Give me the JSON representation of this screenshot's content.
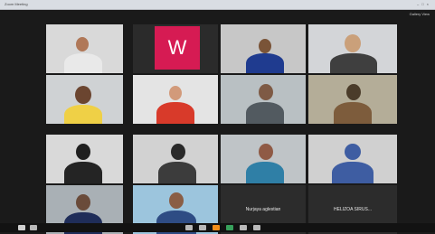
{
  "window": {
    "title": "Zoom Meeting",
    "controls": "–□×"
  },
  "top_right_info": "Gallery View",
  "participants": [
    {
      "id": "p1",
      "label": ""
    },
    {
      "id": "p2",
      "label": "",
      "initial": "W"
    },
    {
      "id": "p3",
      "label": ""
    },
    {
      "id": "p4",
      "label": ""
    },
    {
      "id": "p5",
      "label": ""
    },
    {
      "id": "p6",
      "label": ""
    },
    {
      "id": "p7",
      "label": ""
    },
    {
      "id": "p8",
      "label": ""
    },
    {
      "id": "p9",
      "label": ""
    },
    {
      "id": "p10",
      "label": ""
    },
    {
      "id": "p11",
      "label": ""
    },
    {
      "id": "p12",
      "label": ""
    },
    {
      "id": "p13",
      "label": ""
    },
    {
      "id": "p14",
      "label": ""
    },
    {
      "id": "p15",
      "label": "",
      "name_card": "Nurjaya aglestian"
    },
    {
      "id": "p16",
      "label": "",
      "name_card": "HELIZOA SIRUS..."
    }
  ],
  "colors": {
    "tile_bg": "#2a2a2a",
    "brand_tile": "#d61b53",
    "stage_bg": "#1a1a1a"
  },
  "toolbar_icons": [
    "mic-icon",
    "video-icon",
    "security-icon",
    "participants-icon",
    "chat-icon",
    "share-icon",
    "record-icon",
    "reactions-icon"
  ]
}
